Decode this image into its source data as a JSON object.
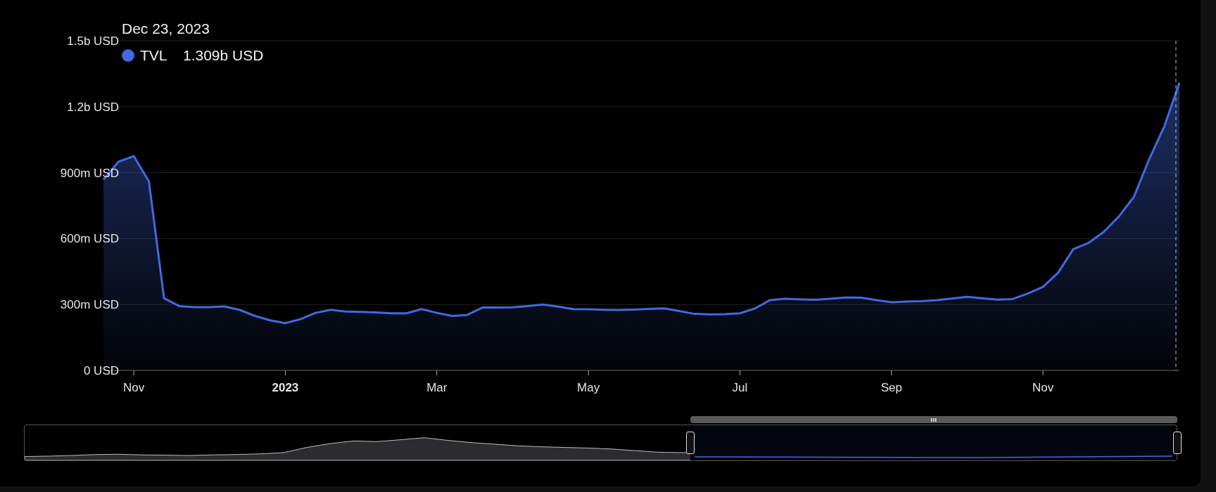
{
  "tooltip": {
    "date": "Dec 23, 2023",
    "value": "1.309b USD",
    "color": "#4169e1"
  },
  "chart": {
    "tick_bold": [
      false,
      true,
      false,
      false,
      false,
      false,
      false
    ],
    "chart_data": {
      "type": "area",
      "grid": true,
      "categories": [
        null,
        null,
        "Nov",
        null,
        null,
        null,
        null,
        null,
        null,
        null,
        null,
        null,
        "2023",
        null,
        null,
        null,
        null,
        null,
        null,
        null,
        null,
        null,
        "Mar",
        null,
        null,
        null,
        null,
        null,
        null,
        null,
        null,
        null,
        "May",
        null,
        null,
        null,
        null,
        null,
        null,
        null,
        null,
        null,
        "Jul",
        null,
        null,
        null,
        null,
        null,
        null,
        null,
        null,
        null,
        "Sep",
        null,
        null,
        null,
        null,
        null,
        null,
        null,
        null,
        null,
        "Nov",
        null,
        null,
        null,
        null,
        null,
        null,
        null,
        null,
        null
      ],
      "series": [
        {
          "name": "TVL",
          "color": "#4169e1",
          "values": [
            868000000,
            950000000,
            975000000,
            860000000,
            328000000,
            293000000,
            288000000,
            288000000,
            291000000,
            275000000,
            248000000,
            228000000,
            215000000,
            233000000,
            262000000,
            276000000,
            268000000,
            266000000,
            264000000,
            260000000,
            260000000,
            279000000,
            262000000,
            248000000,
            252000000,
            286000000,
            286000000,
            287000000,
            293000000,
            300000000,
            290000000,
            279000000,
            278000000,
            276000000,
            275000000,
            277000000,
            280000000,
            282000000,
            270000000,
            257000000,
            255000000,
            256000000,
            260000000,
            282000000,
            320000000,
            326000000,
            323000000,
            321000000,
            326000000,
            332000000,
            331000000,
            320000000,
            310000000,
            313000000,
            315000000,
            320000000,
            327000000,
            335000000,
            328000000,
            322000000,
            325000000,
            350000000,
            380000000,
            445000000,
            552000000,
            580000000,
            630000000,
            700000000,
            790000000,
            960000000,
            1110000000,
            1309000000
          ]
        }
      ],
      "ylim": [
        0,
        1500000000
      ],
      "yticks": [
        {
          "value": 0,
          "label": "0 USD"
        },
        {
          "value": 300000000,
          "label": "300m USD"
        },
        {
          "value": 600000000,
          "label": "600m USD"
        },
        {
          "value": 900000000,
          "label": "900m USD"
        },
        {
          "value": 1200000000,
          "label": "1.2b USD"
        },
        {
          "value": 1500000000,
          "label": "1.5b USD"
        }
      ]
    }
  },
  "range_slider": {
    "level": 0.578
  }
}
